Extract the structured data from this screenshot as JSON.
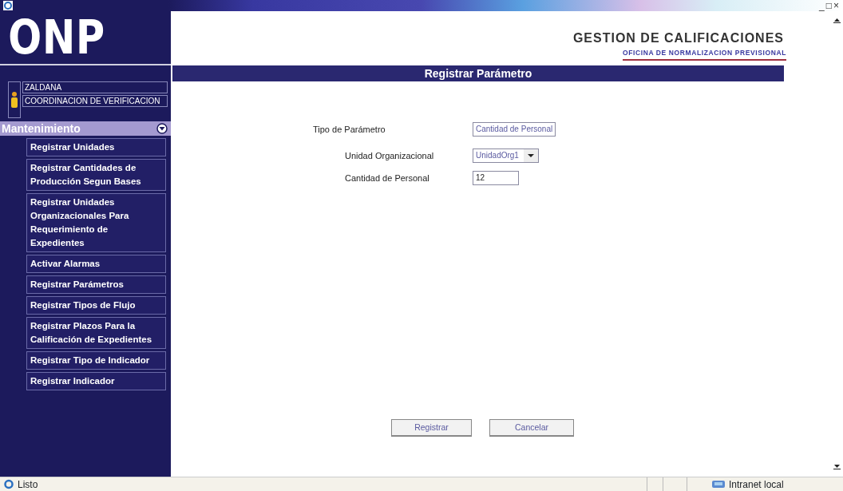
{
  "window_controls": [
    "_",
    "□",
    "×"
  ],
  "logo": "ONP",
  "user": {
    "name": "ZALDANA",
    "area": "COORDINACION DE VERIFICACION"
  },
  "menu": {
    "title": "Mantenimiento",
    "expanded": true,
    "items": [
      {
        "label": "Registrar Unidades"
      },
      {
        "label": "Registrar Cantidades de Producción Segun Bases"
      },
      {
        "label": "Registrar Unidades Organizacionales Para Requerimiento de Expedientes"
      },
      {
        "label": "Activar Alarmas"
      },
      {
        "label": "Registrar Parámetros"
      },
      {
        "label": "Registrar Tipos de Flujo"
      },
      {
        "label": "Registrar Plazos Para la Calificación de Expedientes"
      },
      {
        "label": "Registrar Tipo de Indicador"
      },
      {
        "label": "Registrar Indicador"
      }
    ]
  },
  "header": {
    "title": "GESTION DE CALIFICACIONES",
    "subtitle": "OFICINA DE NORMALIZACION PREVISIONAL"
  },
  "form": {
    "title": "Registrar Parámetro",
    "fields": [
      {
        "kind": "text",
        "label": "Tipo de Parámetro",
        "value": "Cantidad de Personal"
      },
      {
        "kind": "select",
        "label": "Unidad Organizacional",
        "value": "UnidadOrg1"
      },
      {
        "kind": "input",
        "label": "Cantidad de Personal",
        "value": "12"
      }
    ],
    "buttons": [
      "Registrar",
      "Cancelar"
    ]
  },
  "status_bar": {
    "text": "Listo",
    "zone": "Intranet local"
  }
}
